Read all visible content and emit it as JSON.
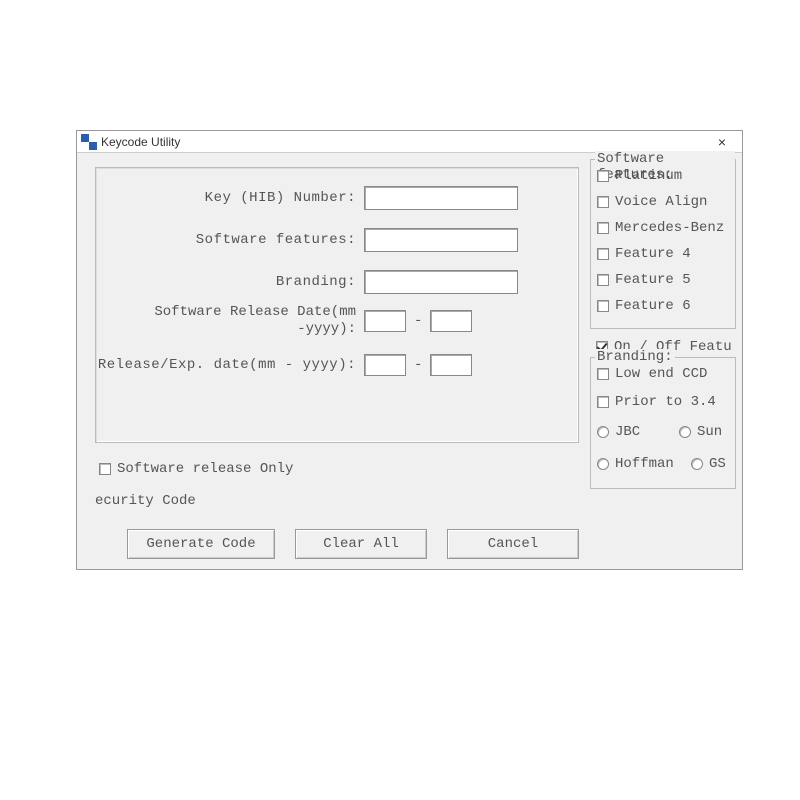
{
  "window": {
    "title": "Keycode Utility"
  },
  "form": {
    "key_number_label": "Key (HIB) Number:",
    "software_features_label": "Software features:",
    "branding_label": "Branding:",
    "release_date_line1": "Software Release Date(mm",
    "release_date_line2": "-yyyy):",
    "exp_date_label": "Release/Exp. date(mm - yyyy):",
    "dash": "-"
  },
  "checkboxes": {
    "release_only": "Software release Only",
    "security_code": "ecurity Code"
  },
  "buttons": {
    "generate": "Generate Code",
    "clear": "Clear All",
    "cancel": "Cancel"
  },
  "features_group": {
    "legend": "Software features:",
    "items": [
      "Platinum",
      "Voice Align",
      "Mercedes-Benz",
      "Feature 4",
      "Feature 5",
      "Feature 6"
    ]
  },
  "onoff": {
    "label": "On / Off Featu",
    "checked": true
  },
  "branding_group": {
    "legend": "Branding:",
    "checks": [
      "Low end CCD",
      "Prior to 3.4"
    ],
    "radios": [
      "JBC",
      "Sun",
      "Hoffman",
      "GS"
    ]
  }
}
